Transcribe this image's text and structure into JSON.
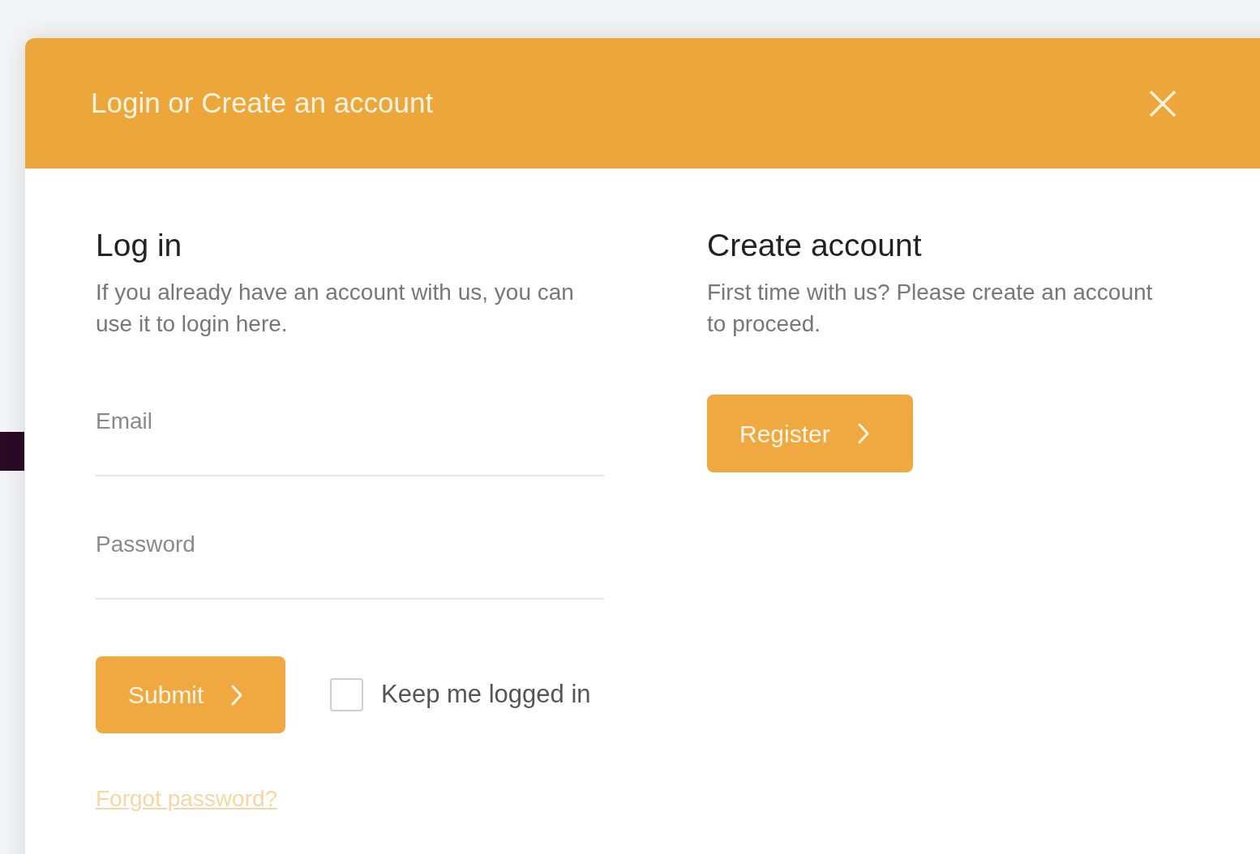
{
  "dialog": {
    "title": "Login or Create an account"
  },
  "login": {
    "heading": "Log in",
    "description": "If you already have an account with us, you can use it to login here.",
    "fields": [
      {
        "placeholder": "Email"
      },
      {
        "placeholder": "Password"
      }
    ],
    "submit": "Submit",
    "remember": {
      "label": "Keep me logged in",
      "checked": false
    },
    "forgot_link": "Forgot password?"
  },
  "register": {
    "heading": "Create account",
    "description": "First time with us? Please create an account to proceed.",
    "button": "Register"
  }
}
